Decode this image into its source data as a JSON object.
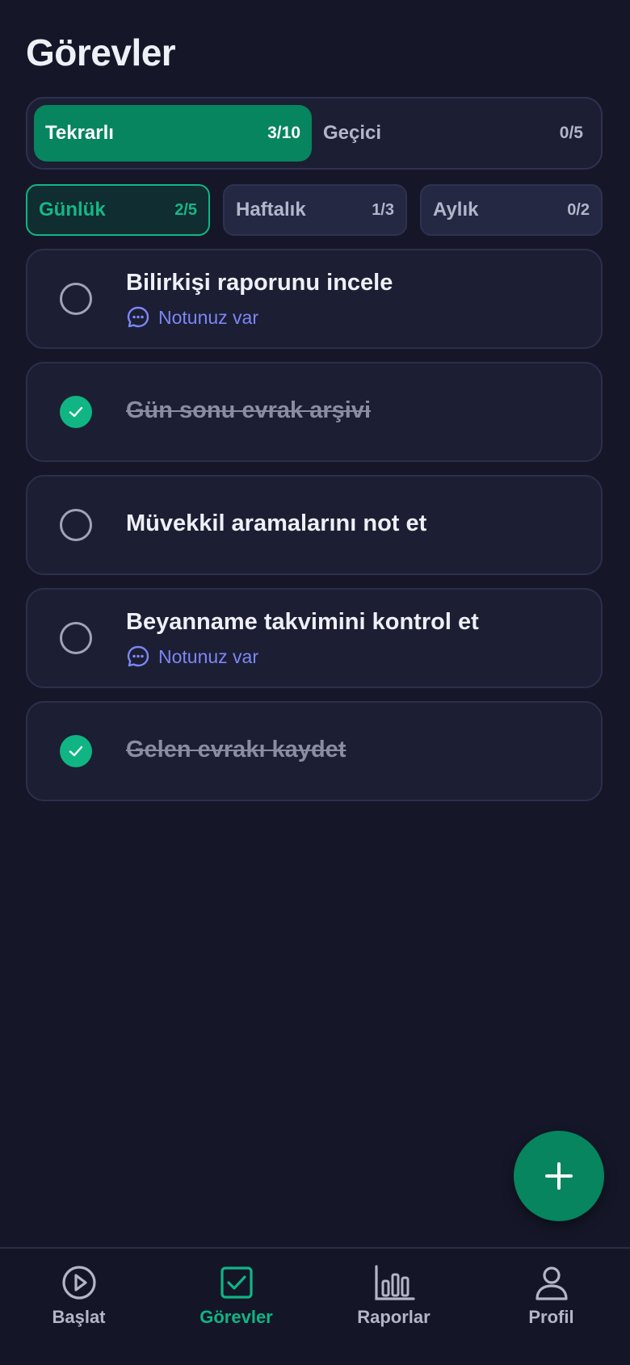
{
  "page": {
    "title": "Görevler"
  },
  "segment": [
    {
      "label": "Tekrarlı",
      "count": "3/10",
      "active": true
    },
    {
      "label": "Geçici",
      "count": "0/5",
      "active": false
    }
  ],
  "frequency": [
    {
      "label": "Günlük",
      "count": "2/5",
      "active": true
    },
    {
      "label": "Haftalık",
      "count": "1/3",
      "active": false
    },
    {
      "label": "Aylık",
      "count": "0/2",
      "active": false
    }
  ],
  "tasks": [
    {
      "title": "Bilirkişi raporunu incele",
      "done": false,
      "note": "Notunuz var"
    },
    {
      "title": "Gün sonu evrak arşivi",
      "done": true
    },
    {
      "title": "Müvekkil aramalarını not et",
      "done": false
    },
    {
      "title": "Beyanname takvimini kontrol et",
      "done": false,
      "note": "Notunuz var"
    },
    {
      "title": "Gelen evrakı kaydet",
      "done": true
    }
  ],
  "fab": {
    "icon": "plus-icon"
  },
  "tabbar": [
    {
      "label": "Başlat",
      "icon": "play-circle-icon",
      "active": false
    },
    {
      "label": "Görevler",
      "icon": "checkbox-icon",
      "active": true
    },
    {
      "label": "Raporlar",
      "icon": "bar-chart-icon",
      "active": false
    },
    {
      "label": "Profil",
      "icon": "user-icon",
      "active": false
    }
  ],
  "colors": {
    "background": "#151729",
    "accent": "#06855e",
    "accent_light": "#10b583",
    "note": "#7c86f5"
  }
}
